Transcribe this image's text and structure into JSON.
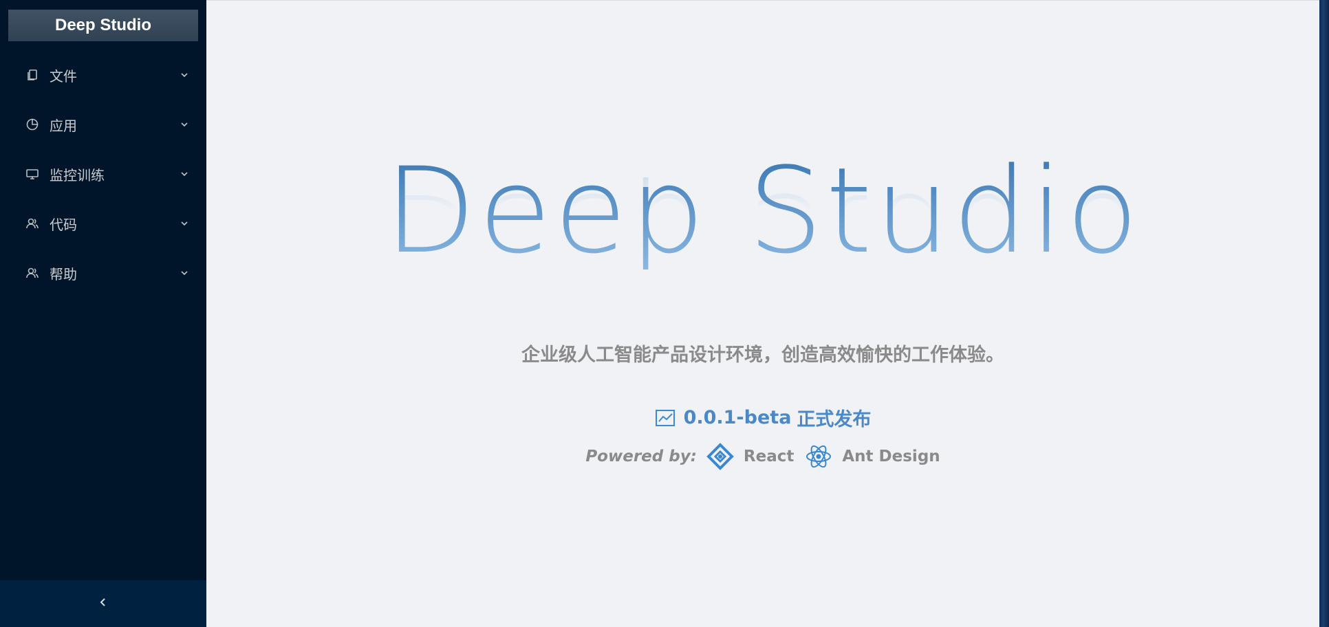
{
  "app": {
    "brand": "Deep Studio"
  },
  "sidebar": {
    "items": [
      {
        "label": "文件",
        "icon": "copy-icon"
      },
      {
        "label": "应用",
        "icon": "pie-chart-icon"
      },
      {
        "label": "监控训练",
        "icon": "desktop-icon"
      },
      {
        "label": "代码",
        "icon": "team-icon"
      },
      {
        "label": "帮助",
        "icon": "team-icon"
      }
    ],
    "collapse_icon": "left-arrow-icon"
  },
  "hero": {
    "title": "Deep Studio",
    "subtitle": "企业级人工智能产品设计环境，创造高效愉快的工作体验。",
    "version_number": "0.0.1-beta",
    "version_text": "正式发布",
    "powered_by": "Powered by:",
    "tech1": "React",
    "tech2": "Ant Design"
  },
  "colors": {
    "sidebar_bg": "#001529",
    "accent": "#4a88c7",
    "main_bg": "#f0f2f6"
  }
}
